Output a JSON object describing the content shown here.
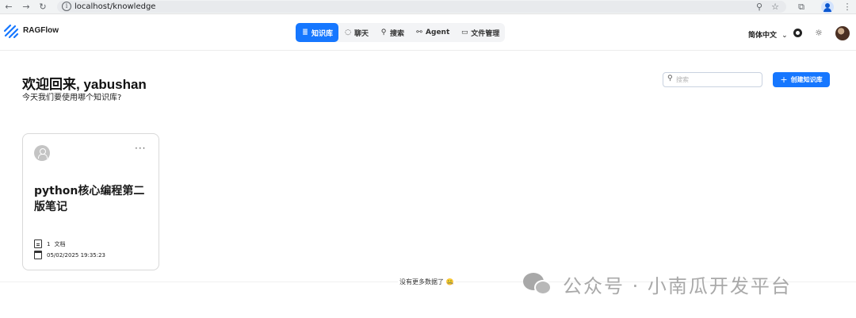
{
  "browser": {
    "url": "localhost/knowledge",
    "icons": [
      "back-icon",
      "forward-icon",
      "reload-icon",
      "info-icon",
      "zoom-icon",
      "star-icon",
      "extensions-icon",
      "profile-icon",
      "menu-icon"
    ]
  },
  "header": {
    "brand": "RAGFlow",
    "nav": [
      {
        "label": "知识库",
        "icon": "database-icon",
        "active": true
      },
      {
        "label": "聊天",
        "icon": "chat-icon",
        "active": false
      },
      {
        "label": "搜索",
        "icon": "search-icon",
        "active": false
      },
      {
        "label": "Agent",
        "icon": "agent-icon",
        "active": false
      },
      {
        "label": "文件管理",
        "icon": "folder-icon",
        "active": false
      }
    ],
    "language": "简体中文",
    "accent": "#1677ff"
  },
  "main": {
    "welcome": "欢迎回来, yabushan",
    "subtitle": "今天我们要使用哪个知识库?",
    "search_placeholder": "搜索",
    "create_button": "创建知识库"
  },
  "cards": [
    {
      "title": "python核心编程第二版笔记",
      "doc_count": "1",
      "doc_label": "文档",
      "date": "05/02/2025 19:35:23"
    }
  ],
  "footer": {
    "no_more": "没有更多数据了",
    "emoji": "🤐"
  },
  "watermark": {
    "text": "公众号 · 小南瓜开发平台"
  }
}
